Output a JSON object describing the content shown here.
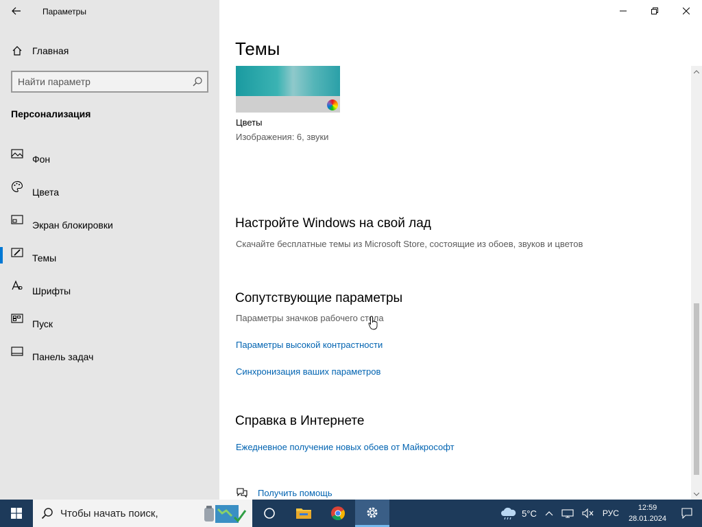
{
  "window": {
    "title": "Параметры"
  },
  "sidebar": {
    "home_label": "Главная",
    "search_placeholder": "Найти параметр",
    "section_title": "Персонализация",
    "items": [
      {
        "label": "Фон",
        "icon": "picture-icon",
        "active": false
      },
      {
        "label": "Цвета",
        "icon": "palette-icon",
        "active": false
      },
      {
        "label": "Экран блокировки",
        "icon": "lock-screen-icon",
        "active": false
      },
      {
        "label": "Темы",
        "icon": "themes-icon",
        "active": true
      },
      {
        "label": "Шрифты",
        "icon": "font-icon",
        "active": false
      },
      {
        "label": "Пуск",
        "icon": "start-icon",
        "active": false
      },
      {
        "label": "Панель задач",
        "icon": "taskbar-icon",
        "active": false
      }
    ]
  },
  "main": {
    "page_title": "Темы",
    "theme": {
      "name": "Цветы",
      "meta": "Изображения: 6, звуки"
    },
    "customize": {
      "heading": "Настройте Windows на свой лад",
      "description": "Скачайте бесплатные темы из Microsoft Store, состоящие из обоев, звуков и цветов"
    },
    "related": {
      "heading": "Сопутствующие параметры",
      "items": [
        {
          "label": "Параметры значков рабочего стола",
          "enabled": false
        },
        {
          "label": "Параметры высокой контрастности",
          "enabled": true
        },
        {
          "label": "Синхронизация ваших параметров",
          "enabled": true
        }
      ]
    },
    "help": {
      "heading": "Справка в Интернете",
      "link": "Ежедневное получение новых обоев от Майкрософт",
      "get_help": "Получить помощь"
    }
  },
  "taskbar": {
    "search_placeholder": "Чтобы начать поиск,",
    "weather": "5°C",
    "language": "РУС",
    "time": "12:59",
    "date": "28.01.2024",
    "apps": [
      "task-view-icon",
      "file-explorer-icon",
      "chrome-icon",
      "settings-icon"
    ]
  },
  "colors": {
    "accent": "#0078d4",
    "link": "#0063b1",
    "sidebar_bg": "#e6e6e6",
    "taskbar_bg": "#1d3a5a"
  }
}
